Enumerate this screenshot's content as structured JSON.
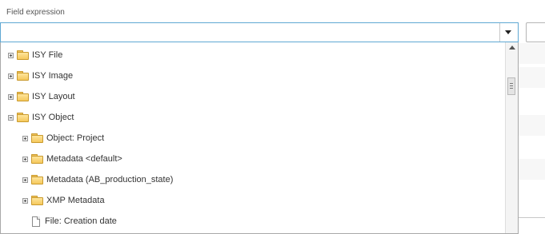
{
  "field": {
    "label": "Field expression",
    "value": "",
    "placeholder": ""
  },
  "tree": {
    "items": [
      {
        "label": "ISY File",
        "expander": "plus"
      },
      {
        "label": "ISY Image",
        "expander": "plus"
      },
      {
        "label": "ISY Layout",
        "expander": "plus"
      },
      {
        "label": "ISY Object",
        "expander": "minus"
      },
      {
        "label": "Object: Project",
        "expander": "plus"
      },
      {
        "label": "Metadata <default>",
        "expander": "plus"
      },
      {
        "label": "Metadata (AB_production_state)",
        "expander": "plus"
      },
      {
        "label": "XMP Metadata",
        "expander": "plus"
      },
      {
        "label": "File: Creation date",
        "expander": "none"
      }
    ]
  },
  "icons": {
    "expander": "tree-expander-icon",
    "folder": "folder-icon",
    "file": "file-icon",
    "dropdown": "chevron-down-icon"
  },
  "colors": {
    "focus_border": "#5fa8d3",
    "folder": "#f5c85c"
  }
}
